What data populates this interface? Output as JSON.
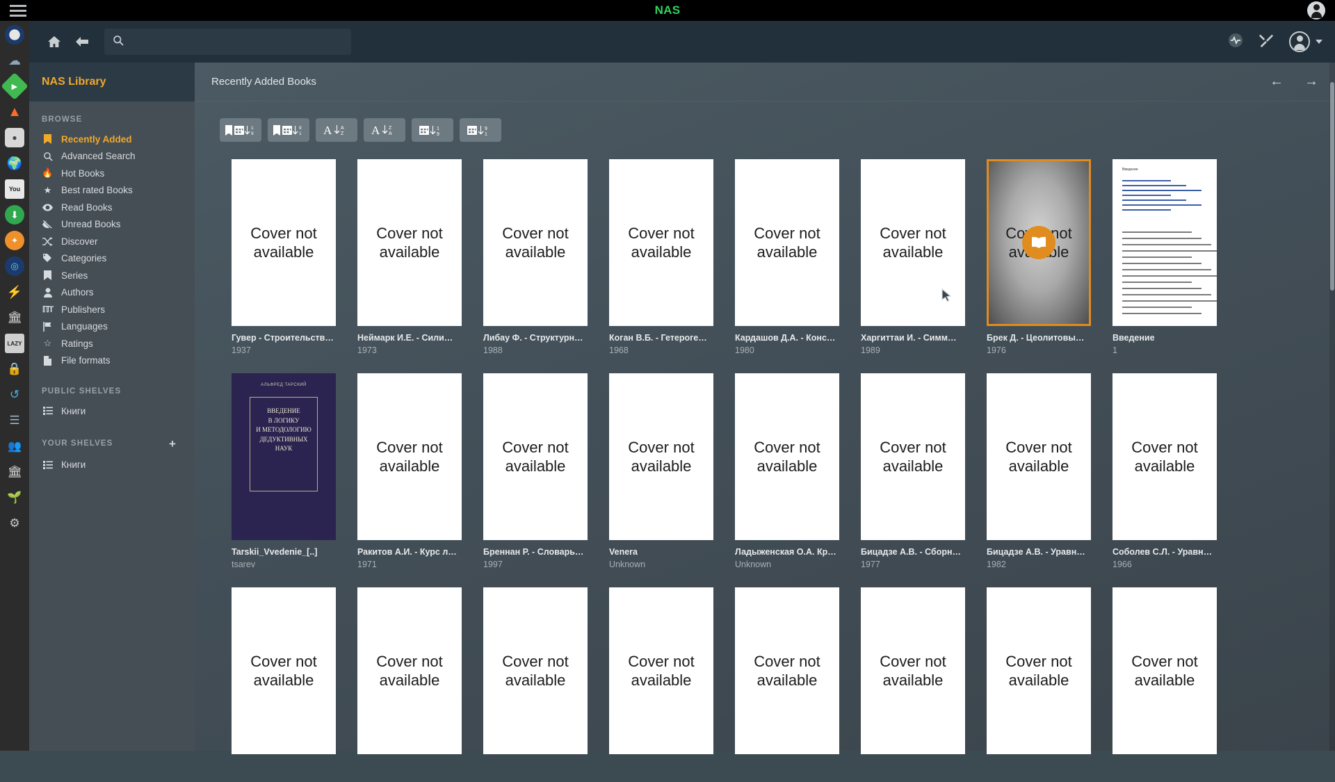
{
  "os": {
    "title": "NAS",
    "menu_icon": "hamburger-icon",
    "user_icon": "user-account-icon",
    "dock_apps": [
      {
        "name": "speedometer-icon"
      },
      {
        "name": "cloud-icon"
      },
      {
        "name": "play-green-icon"
      },
      {
        "name": "gitlab-fox-icon"
      },
      {
        "name": "transmission-icon"
      },
      {
        "name": "jdownloader-icon"
      },
      {
        "name": "youtube-icon"
      },
      {
        "name": "download-green-icon"
      },
      {
        "name": "orange-compass-icon"
      },
      {
        "name": "blue-target-icon"
      },
      {
        "name": "flash-icon"
      },
      {
        "name": "bank-icon"
      },
      {
        "name": "lazy-icon"
      },
      {
        "name": "lock-icon"
      },
      {
        "name": "syncthing-icon"
      },
      {
        "name": "database-icon"
      },
      {
        "name": "users-icon"
      },
      {
        "name": "library-icon"
      },
      {
        "name": "plant-icon"
      },
      {
        "name": "gear-icon"
      }
    ]
  },
  "header": {
    "home_icon": "home-icon",
    "back_icon": "back-arrow-icon",
    "search_icon": "search-icon",
    "search_value": "",
    "search_placeholder": "",
    "pulse_icon": "activity-pulse-icon",
    "tools_icon": "wrench-screwdriver-icon",
    "avatar_icon": "user-avatar-icon",
    "caret_icon": "chevron-down-icon"
  },
  "sidebar": {
    "title": "NAS Library",
    "browse_label": "BROWSE",
    "browse_items": [
      {
        "label": "Recently Added",
        "icon": "book-icon",
        "active": true
      },
      {
        "label": "Advanced Search",
        "icon": "search-icon",
        "active": false
      },
      {
        "label": "Hot Books",
        "icon": "fire-icon",
        "active": false
      },
      {
        "label": "Best rated Books",
        "icon": "star-filled-icon",
        "active": false
      },
      {
        "label": "Read Books",
        "icon": "eye-icon",
        "active": false
      },
      {
        "label": "Unread Books",
        "icon": "eye-slash-icon",
        "active": false
      },
      {
        "label": "Discover",
        "icon": "shuffle-icon",
        "active": false
      },
      {
        "label": "Categories",
        "icon": "tags-icon",
        "active": false
      },
      {
        "label": "Series",
        "icon": "bookmark-icon",
        "active": false
      },
      {
        "label": "Authors",
        "icon": "person-icon",
        "active": false
      },
      {
        "label": "Publishers",
        "icon": "text-height-icon",
        "active": false
      },
      {
        "label": "Languages",
        "icon": "flag-icon",
        "active": false
      },
      {
        "label": "Ratings",
        "icon": "star-outline-icon",
        "active": false
      },
      {
        "label": "File formats",
        "icon": "file-icon",
        "active": false
      }
    ],
    "public_shelves_label": "PUBLIC SHELVES",
    "public_shelves": [
      {
        "label": "Книги",
        "icon": "list-icon"
      }
    ],
    "your_shelves_label": "YOUR SHELVES",
    "add_shelf_icon": "plus-icon",
    "your_shelves": [
      {
        "label": "Книги",
        "icon": "list-icon"
      }
    ]
  },
  "main": {
    "title": "Recently Added Books",
    "prev_icon": "arrow-left-icon",
    "next_icon": "arrow-right-icon",
    "sort_buttons": [
      {
        "name": "sort-by-date-ascending",
        "icon": "book-calendar-1-9-icon"
      },
      {
        "name": "sort-by-date-descending",
        "icon": "book-calendar-9-1-icon"
      },
      {
        "name": "sort-title-a-z",
        "icon": "a-z-down-icon"
      },
      {
        "name": "sort-title-z-a",
        "icon": "z-a-down-icon"
      },
      {
        "name": "sort-list-ascending",
        "icon": "list-1-9-icon"
      },
      {
        "name": "sort-list-descending",
        "icon": "list-9-1-icon"
      }
    ],
    "cover_placeholder": "Cover not available",
    "books": [
      {
        "title": "Гувер - Строительств…",
        "sub": "1937",
        "cover": "placeholder"
      },
      {
        "title": "Неймарк И.Е. - Сили…",
        "sub": "1973",
        "cover": "placeholder"
      },
      {
        "title": "Либау Ф. - Структурн…",
        "sub": "1988",
        "cover": "placeholder"
      },
      {
        "title": "Коган В.Б. - Гетероге…",
        "sub": "1968",
        "cover": "placeholder"
      },
      {
        "title": "Кардашов Д.А. - Конс…",
        "sub": "1980",
        "cover": "placeholder"
      },
      {
        "title": "Харгиттаи И. - Симм…",
        "sub": "1989",
        "cover": "placeholder"
      },
      {
        "title": "Брек Д. - Цеолитовы…",
        "sub": "1976",
        "cover": "placeholder",
        "hovered": true
      },
      {
        "title": "Введение",
        "sub": "1",
        "cover": "document"
      },
      {
        "title": "Tarskii_Vvedenie_[..]",
        "sub": "tsarev",
        "cover": "dark-book"
      },
      {
        "title": "Ракитов А.И. - Курс л…",
        "sub": "1971",
        "cover": "placeholder"
      },
      {
        "title": "Бреннан Р. - Словарь…",
        "sub": "1997",
        "cover": "placeholder"
      },
      {
        "title": "Venera",
        "sub": "Unknown",
        "cover": "placeholder"
      },
      {
        "title": "Ладыженская О.А. Кр…",
        "sub": "Unknown",
        "cover": "placeholder"
      },
      {
        "title": "Бицадзе А.В. - Сборн…",
        "sub": "1977",
        "cover": "placeholder"
      },
      {
        "title": "Бицадзе А.В. - Уравн…",
        "sub": "1982",
        "cover": "placeholder"
      },
      {
        "title": "Соболев С.Л. - Уравн…",
        "sub": "1966",
        "cover": "placeholder"
      },
      {
        "title": "",
        "sub": "",
        "cover": "placeholder"
      },
      {
        "title": "",
        "sub": "",
        "cover": "placeholder"
      },
      {
        "title": "",
        "sub": "",
        "cover": "placeholder"
      },
      {
        "title": "",
        "sub": "",
        "cover": "placeholder"
      },
      {
        "title": "",
        "sub": "",
        "cover": "placeholder"
      },
      {
        "title": "",
        "sub": "",
        "cover": "placeholder"
      },
      {
        "title": "",
        "sub": "",
        "cover": "placeholder"
      },
      {
        "title": "",
        "sub": "",
        "cover": "placeholder"
      }
    ],
    "dark_book_cover": {
      "series": "АЛЬФРЕД ТАРСКИЙ",
      "line1": "ВВЕДЕНИЕ",
      "line2": "В ЛОГИКУ",
      "line3": "И МЕТОДОЛОГИЮ",
      "line4": "ДЕДУКТИВНЫХ",
      "line5": "НАУК"
    },
    "read_button_icon": "open-book-icon"
  },
  "colors": {
    "accent": "#f0a92b",
    "hover_border": "#e08c1e",
    "sidebar_bg": "#454e55",
    "header_bg": "#21303a"
  }
}
